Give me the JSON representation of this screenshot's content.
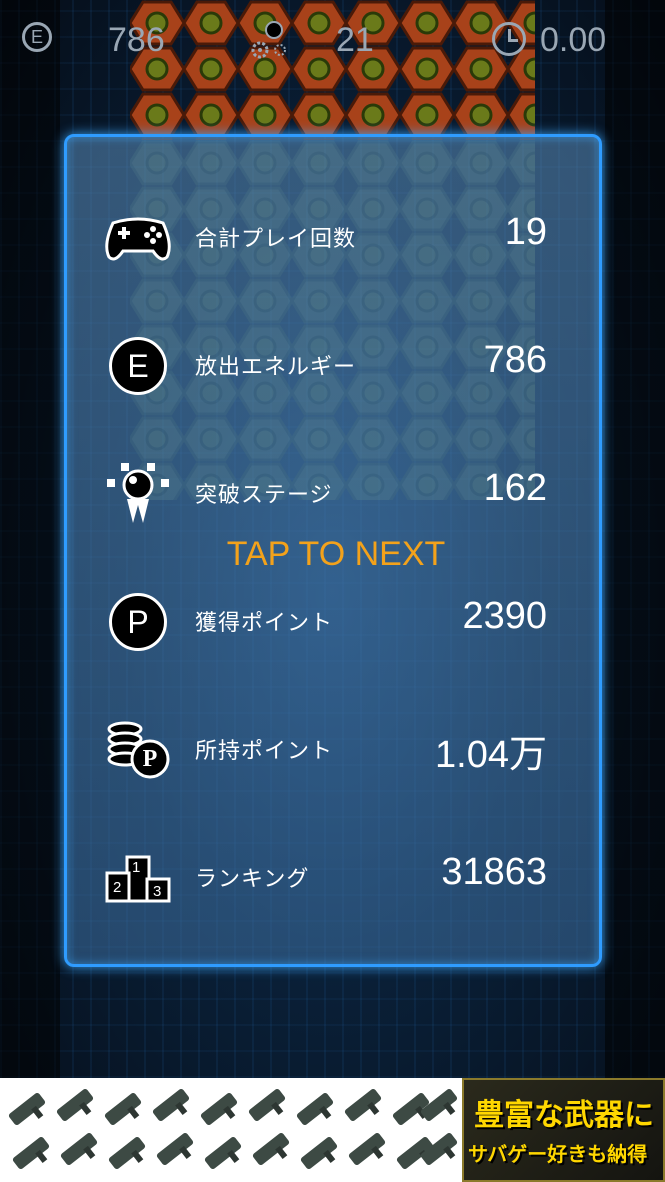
{
  "hud": {
    "energy_icon_letter": "E",
    "energy": "786",
    "stage": "21",
    "time": "0.00"
  },
  "stats": [
    {
      "label": "合計プレイ回数",
      "value": "19"
    },
    {
      "label": "放出エネルギー",
      "value": "786",
      "icon_letter": "E"
    },
    {
      "label": "突破ステージ",
      "value": "162"
    },
    {
      "label": "獲得ポイント",
      "value": "2390",
      "icon_letter": "P"
    },
    {
      "label": "所持ポイント",
      "value": "1.04万",
      "icon_letter": "P"
    },
    {
      "label": "ランキング",
      "value": "31863",
      "podium": [
        "1",
        "2",
        "3"
      ]
    }
  ],
  "tap_text": "TAP TO NEXT",
  "ad": {
    "line1": "豊富な武器に",
    "line2": "サバゲー好きも納得"
  },
  "colors": {
    "panel_border": "#2f9cff",
    "tap_text": "#f3a21b",
    "ad_text": "#ffd700"
  },
  "icons": [
    "controller-icon",
    "energy-icon",
    "bomb-icon",
    "points-icon",
    "coins-icon",
    "podium-icon",
    "clock-icon",
    "gear-bomb-icon"
  ]
}
